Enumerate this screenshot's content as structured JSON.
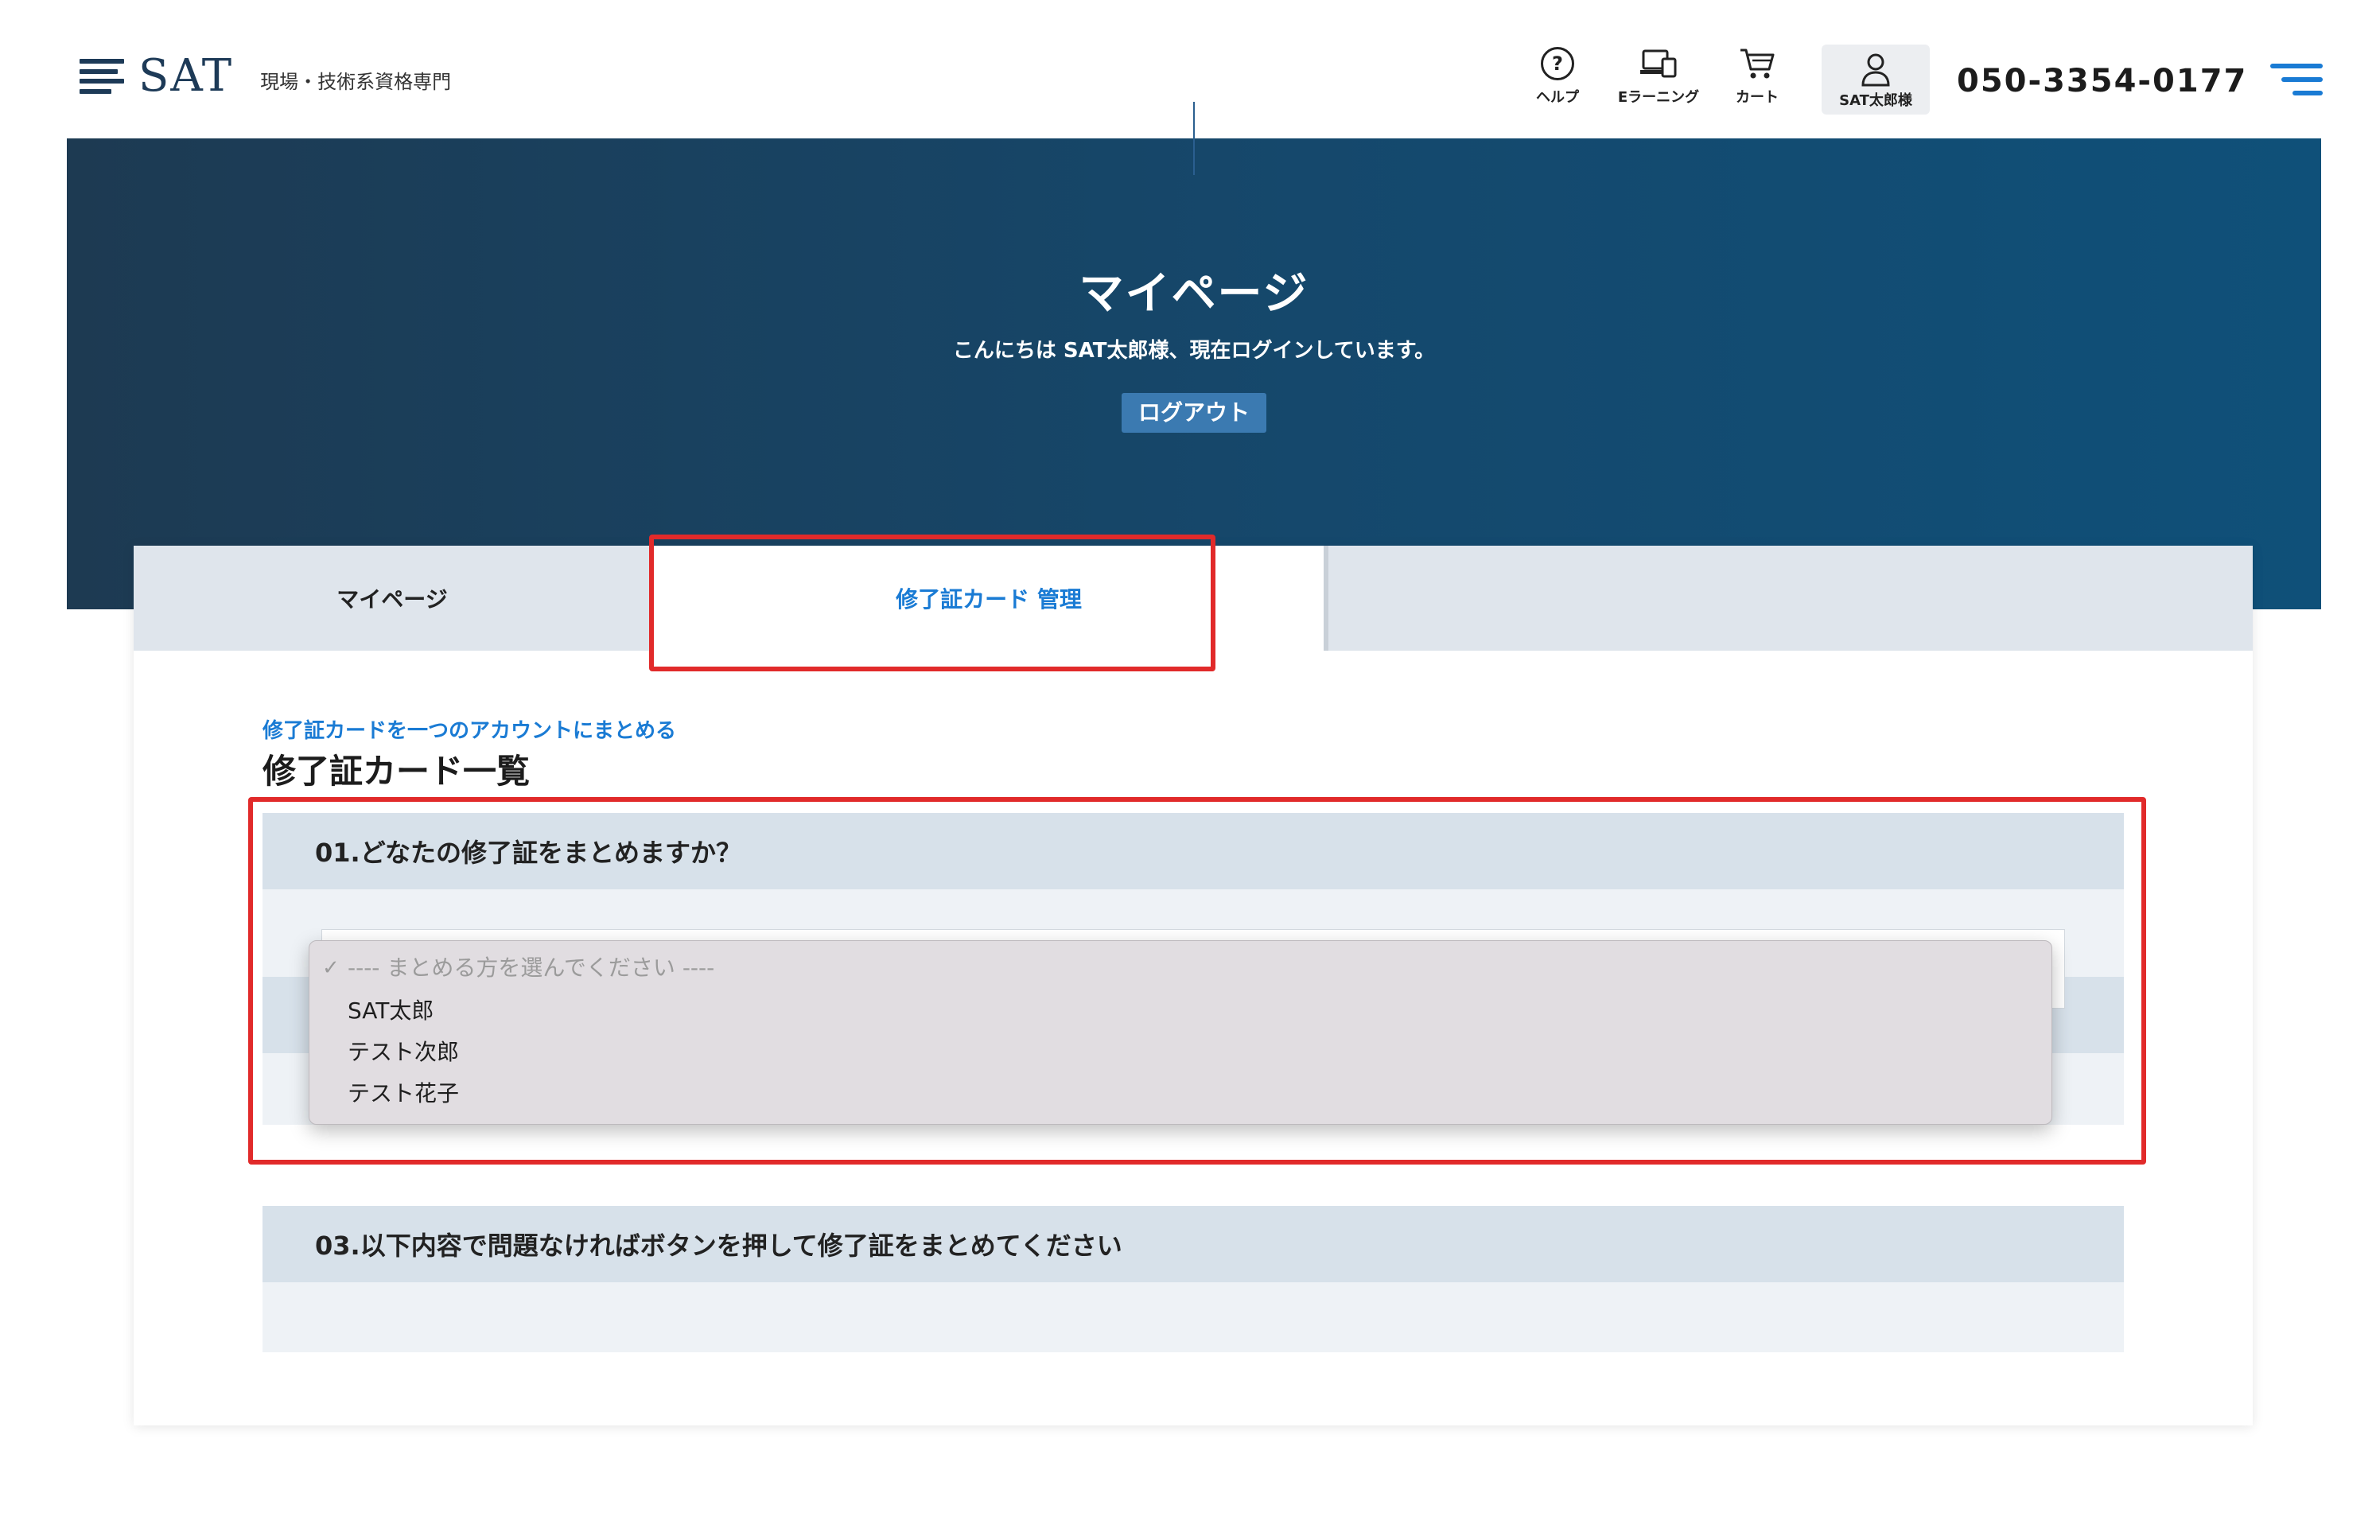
{
  "header": {
    "logo_text": "SAT",
    "tagline": "現場・技術系資格専門",
    "nav": {
      "help": "ヘルプ",
      "elearning": "Eラーニング",
      "cart": "カート",
      "user": "SAT太郎様"
    },
    "phone": "050-3354-0177"
  },
  "hero": {
    "title": "マイページ",
    "greeting": "こんにちは SAT太郎様、現在ログインしています。",
    "logout_label": "ログアウト"
  },
  "tabs": {
    "mypage": "マイページ",
    "cards": "修了証カード 管理"
  },
  "content": {
    "merge_link": "修了証カードを一つのアカウントにまとめる",
    "section_title": "修了証カード一覧",
    "step1": "01.どなたの修了証をまとめますか？",
    "step3": "03.以下内容で問題なければボタンを押して修了証をまとめてください"
  },
  "dropdown": {
    "check": "✓",
    "placeholder": "---- まとめる方を選んでください ----",
    "options": [
      "SAT太郎",
      "テスト次郎",
      "テスト花子"
    ]
  },
  "colors": {
    "accent": "#1a7bd4",
    "highlight": "#e12a2a",
    "hero_start": "#1d3a52",
    "hero_end": "#0f5079"
  }
}
